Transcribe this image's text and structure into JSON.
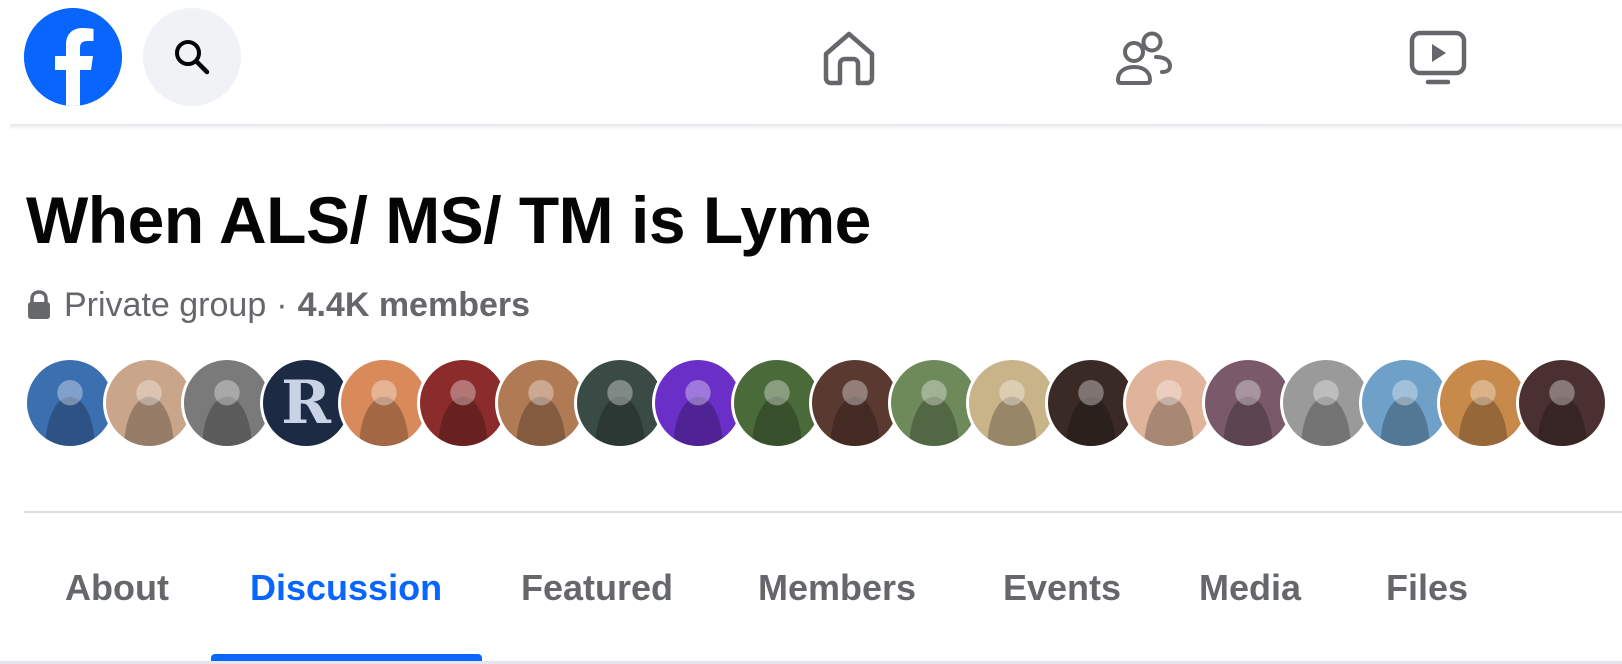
{
  "brand": {
    "accent": "#0866ff"
  },
  "topbar": {
    "logo_icon": "facebook-logo-icon",
    "search_icon": "search-icon",
    "nav": [
      "home-icon",
      "friends-icon",
      "video-icon"
    ]
  },
  "group": {
    "name": "When ALS/ MS/ TM is Lyme",
    "privacy": "Private group",
    "separator": "·",
    "members": "4.4K members"
  },
  "avatars": [
    {
      "icon": "member-avatar-1",
      "color": "#3b6fb0"
    },
    {
      "icon": "member-avatar-2",
      "color": "#c9a58a"
    },
    {
      "icon": "member-avatar-3",
      "color": "#7a7a7a"
    },
    {
      "icon": "member-avatar-4",
      "color": "#1d2a44",
      "letter": "R"
    },
    {
      "icon": "member-avatar-5",
      "color": "#d98a5b"
    },
    {
      "icon": "member-avatar-6",
      "color": "#8b2b2b"
    },
    {
      "icon": "member-avatar-7",
      "color": "#b07a55"
    },
    {
      "icon": "member-avatar-8",
      "color": "#3a4b46"
    },
    {
      "icon": "member-avatar-9",
      "color": "#6a2fc7"
    },
    {
      "icon": "member-avatar-10",
      "color": "#4b6a3a"
    },
    {
      "icon": "member-avatar-11",
      "color": "#5a3a30"
    },
    {
      "icon": "member-avatar-12",
      "color": "#6e8a5a"
    },
    {
      "icon": "member-avatar-13",
      "color": "#c9b48a"
    },
    {
      "icon": "member-avatar-14",
      "color": "#3a2a26"
    },
    {
      "icon": "member-avatar-15",
      "color": "#e0b49a"
    },
    {
      "icon": "member-avatar-16",
      "color": "#7a5a6a"
    },
    {
      "icon": "member-avatar-17",
      "color": "#9a9a9a"
    },
    {
      "icon": "member-avatar-18",
      "color": "#6fa0c8"
    },
    {
      "icon": "member-avatar-19",
      "color": "#c88a4a"
    },
    {
      "icon": "member-avatar-20",
      "color": "#4a3030"
    }
  ],
  "tabs": [
    {
      "label": "About",
      "active": false
    },
    {
      "label": "Discussion",
      "active": true
    },
    {
      "label": "Featured",
      "active": false
    },
    {
      "label": "Members",
      "active": false
    },
    {
      "label": "Events",
      "active": false
    },
    {
      "label": "Media",
      "active": false
    },
    {
      "label": "Files",
      "active": false
    }
  ]
}
